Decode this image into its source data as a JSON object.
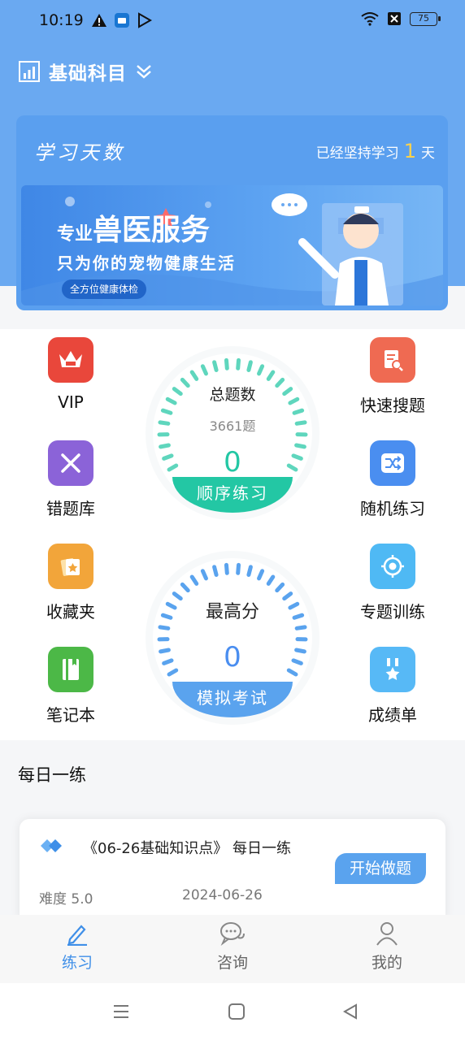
{
  "status_bar": {
    "time": "10:19",
    "battery": "75"
  },
  "header": {
    "title": "基础科目"
  },
  "banner": {
    "slogan": "学习天数",
    "persist_prefix": "已经坚持学习",
    "days": "1",
    "persist_suffix": "天",
    "ad": {
      "line1_small": "专业",
      "line1_big": "兽医服务",
      "line2": "只为你的宠物健康生活",
      "pill": "全方位健康体检"
    }
  },
  "features": {
    "vip": "VIP",
    "quick_search": "快速搜题",
    "wrong_bank": "错题库",
    "random_practice": "随机练习",
    "favorites": "收藏夹",
    "topic_training": "专题训练",
    "notebook": "笔记本",
    "scores": "成绩单"
  },
  "gauge_total": {
    "title": "总题数",
    "count": "3661题",
    "value": "0",
    "button": "顺序练习"
  },
  "gauge_best": {
    "title": "最高分",
    "value": "0",
    "button": "模拟考试"
  },
  "daily": {
    "section_title": "每日一练",
    "item_name": "《06-26基础知识点》 每日一练",
    "start_button": "开始做题",
    "difficulty": "难度 5.0",
    "date": "2024-06-26"
  },
  "tabs": {
    "practice": "练习",
    "consult": "咨询",
    "mine": "我的"
  },
  "colors": {
    "accent": "#5aa3ee",
    "teal": "#23c7a4",
    "vip_red": "#e9473b"
  }
}
